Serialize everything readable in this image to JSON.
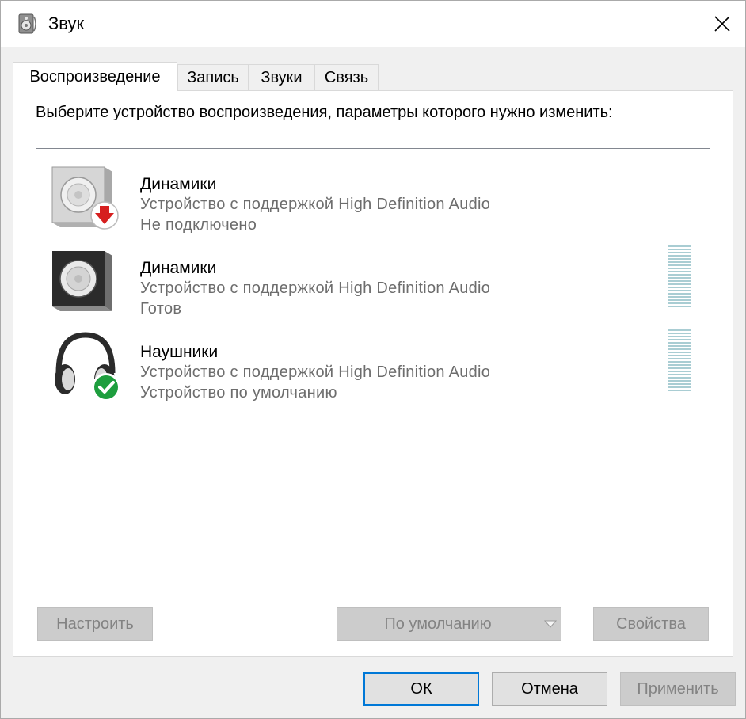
{
  "window": {
    "title": "Звук"
  },
  "tabs": [
    {
      "label": "Воспроизведение",
      "active": true
    },
    {
      "label": "Запись",
      "active": false
    },
    {
      "label": "Звуки",
      "active": false
    },
    {
      "label": "Связь",
      "active": false
    }
  ],
  "panel": {
    "instruction": "Выберите устройство воспроизведения, параметры которого нужно изменить:"
  },
  "devices": [
    {
      "name": "Динамики",
      "description": "Устройство с поддержкой High Definition Audio",
      "status": "Не подключено",
      "icon": "speaker-disconnected-icon",
      "level_meter": false
    },
    {
      "name": "Динамики",
      "description": "Устройство с поддержкой High Definition Audio",
      "status": "Готов",
      "icon": "speaker-icon",
      "level_meter": true
    },
    {
      "name": "Наушники",
      "description": "Устройство с поддержкой High Definition Audio",
      "status": "Устройство по умолчанию",
      "icon": "headphones-default-icon",
      "level_meter": true
    }
  ],
  "buttons": {
    "configure": "Настроить",
    "set_default": "По умолчанию",
    "properties": "Свойства",
    "ok": "ОК",
    "cancel": "Отмена",
    "apply": "Применить"
  },
  "colors": {
    "accent": "#0078d7",
    "check_green": "#1e9e3e",
    "error_red": "#d61f1f",
    "meter": "#a9cdd3"
  }
}
